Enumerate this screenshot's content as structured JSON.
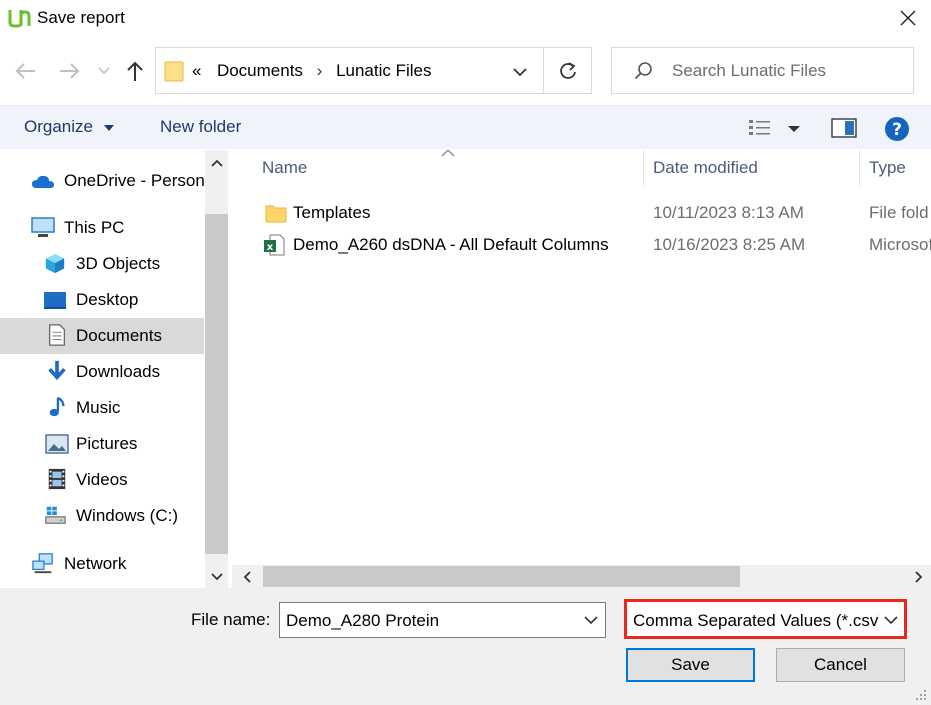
{
  "window": {
    "title": "Save report",
    "close_glyph": "✕"
  },
  "nav": {
    "back_glyph": "←",
    "forward_glyph": "→",
    "recent_glyph": "⌄",
    "up_glyph": "↑"
  },
  "address": {
    "prefix": "«",
    "segments": [
      "Documents",
      "Lunatic Files"
    ],
    "separator": "›"
  },
  "search": {
    "placeholder": "Search Lunatic Files"
  },
  "toolbar": {
    "organize_label": "Organize",
    "organize_caret": "▾",
    "new_folder_label": "New folder"
  },
  "sidebar": {
    "items": [
      {
        "label": "OneDrive - Person",
        "icon": "cloud-icon"
      },
      {
        "label": "This PC",
        "icon": "computer-icon"
      },
      {
        "label": "3D Objects",
        "icon": "cube-icon"
      },
      {
        "label": "Desktop",
        "icon": "desktop-icon"
      },
      {
        "label": "Documents",
        "icon": "document-icon",
        "selected": true
      },
      {
        "label": "Downloads",
        "icon": "download-icon"
      },
      {
        "label": "Music",
        "icon": "music-icon"
      },
      {
        "label": "Pictures",
        "icon": "picture-icon"
      },
      {
        "label": "Videos",
        "icon": "video-icon"
      },
      {
        "label": "Windows (C:)",
        "icon": "drive-icon"
      },
      {
        "label": "Network",
        "icon": "network-icon"
      }
    ]
  },
  "file_list": {
    "columns": {
      "name": "Name",
      "date": "Date modified",
      "type": "Type"
    },
    "rows": [
      {
        "name": "Templates",
        "date": "10/11/2023 8:13 AM",
        "type": "File fold",
        "icon": "folder-icon"
      },
      {
        "name": "Demo_A260 dsDNA - All Default Columns",
        "date": "10/16/2023 8:25 AM",
        "type": "Microsoft",
        "icon": "excel-icon"
      }
    ]
  },
  "footer": {
    "file_name_label": "File name:",
    "file_name_value": "Demo_A280 Protein",
    "file_type_value": "Comma Separated Values (*.csv)",
    "save_label": "Save",
    "cancel_label": "Cancel"
  },
  "colors": {
    "accent": "#0078d7",
    "highlight_border": "#e8281c",
    "selected_bg": "#d9d9d9",
    "toolbar_bg": "#f0f3f9",
    "help_blue": "#1565c0"
  }
}
